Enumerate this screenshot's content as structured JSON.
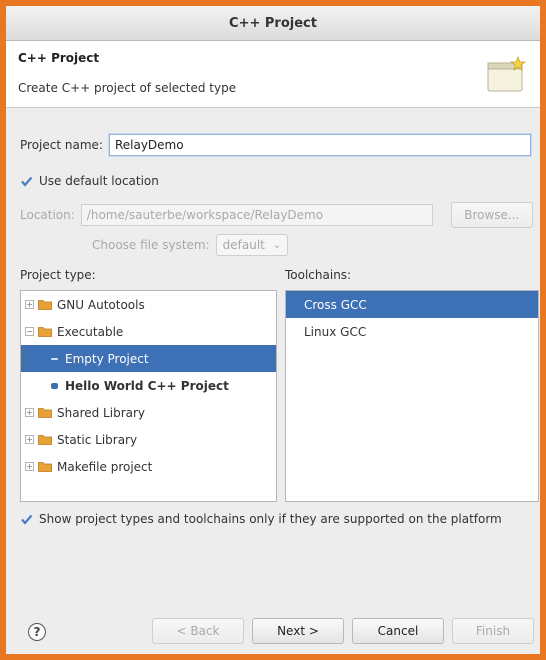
{
  "window": {
    "title": "C++ Project"
  },
  "banner": {
    "title": "C++ Project",
    "description": "Create C++ project of selected type",
    "icon": "wizard-banner-icon"
  },
  "project_name": {
    "label": "Project name:",
    "value": "RelayDemo"
  },
  "use_default_location": {
    "label": "Use default location",
    "checked": true
  },
  "location": {
    "label": "Location:",
    "value": "/home/sauterbe/workspace/RelayDemo",
    "browse_label": "Browse...",
    "filesystem_label": "Choose file system:",
    "filesystem_value": "default"
  },
  "project_type": {
    "heading": "Project type:",
    "items": [
      {
        "label": "GNU Autotools",
        "kind": "folder",
        "expander": "+"
      },
      {
        "label": "Executable",
        "kind": "folder",
        "expander": "-"
      },
      {
        "label": "Empty Project",
        "kind": "template",
        "selected": true
      },
      {
        "label": "Hello World C++ Project",
        "kind": "template"
      },
      {
        "label": "Shared Library",
        "kind": "folder",
        "expander": "+"
      },
      {
        "label": "Static Library",
        "kind": "folder",
        "expander": "+"
      },
      {
        "label": "Makefile project",
        "kind": "folder",
        "expander": "+"
      }
    ]
  },
  "toolchains": {
    "heading": "Toolchains:",
    "items": [
      {
        "label": "Cross GCC",
        "selected": true
      },
      {
        "label": "Linux GCC"
      }
    ]
  },
  "show_supported": {
    "label": "Show project types and toolchains only if they are supported on the platform",
    "checked": true
  },
  "buttons": {
    "back": "< Back",
    "next": "Next >",
    "cancel": "Cancel",
    "finish": "Finish",
    "help": "?"
  },
  "colors": {
    "frame": "#e87722",
    "selection": "#3d70b5",
    "folder": "#e8a135",
    "checkbox": "#4a7cc2"
  }
}
